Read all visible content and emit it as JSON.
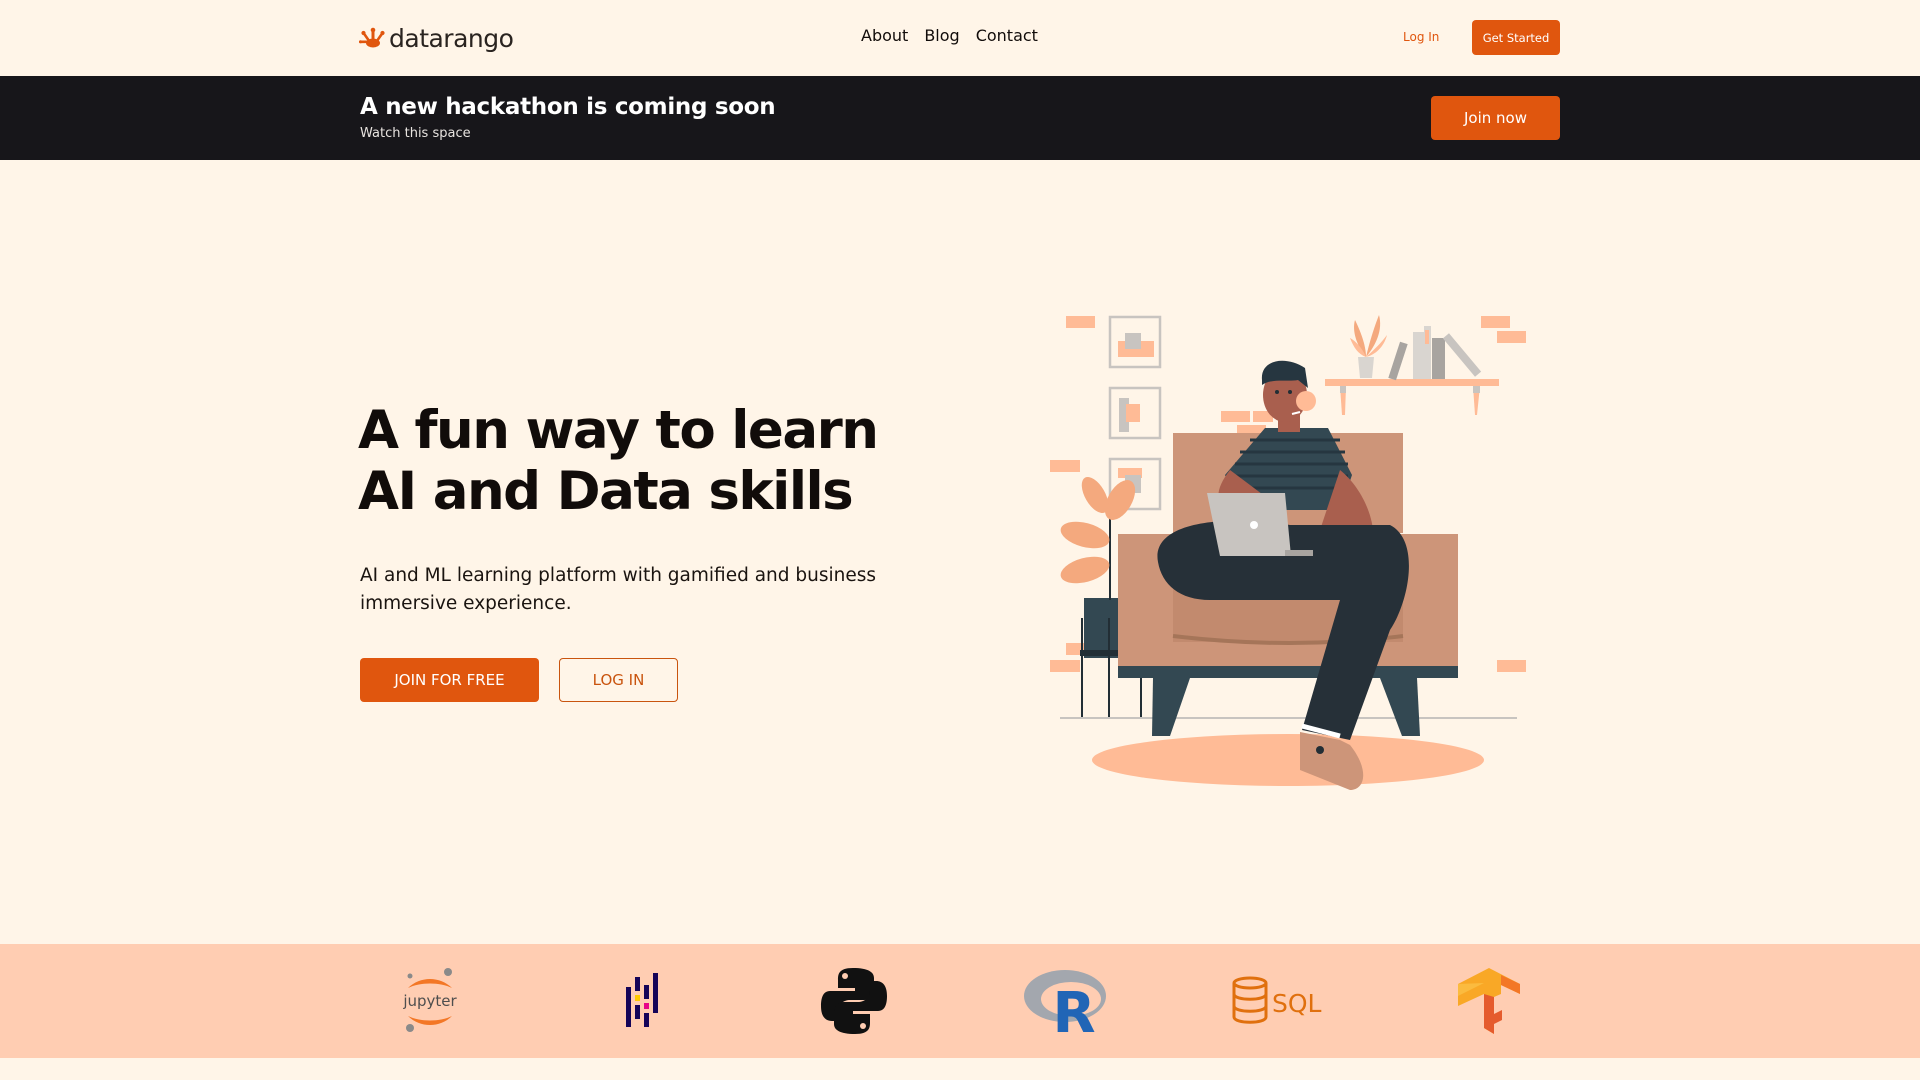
{
  "nav": {
    "brand": "datarango",
    "links": [
      {
        "label": "About"
      },
      {
        "label": "Blog"
      },
      {
        "label": "Contact"
      }
    ],
    "login_label": "Log In",
    "cta_label": "Get Started"
  },
  "banner": {
    "title": "A new hackathon is coming soon",
    "subtitle": "Watch this space",
    "button_label": "Join now"
  },
  "hero": {
    "title_line1": "A fun way to learn",
    "title_line2": "AI and Data skills",
    "description": "AI and ML learning platform with gamified and business immersive experience.",
    "primary_button": "JOIN FOR FREE",
    "secondary_button": "LOG IN",
    "illustration": "person-with-laptop-on-armchair"
  },
  "tech_logos": [
    {
      "name": "jupyter",
      "text": "jupyter"
    },
    {
      "name": "pandas"
    },
    {
      "name": "python"
    },
    {
      "name": "r",
      "text": "R"
    },
    {
      "name": "sql",
      "text": "SQL"
    },
    {
      "name": "tensorflow"
    }
  ],
  "colors": {
    "accent": "#e0560e",
    "background": "#fff5e8",
    "banner": "#17161a",
    "band": "#ffcdb2"
  }
}
